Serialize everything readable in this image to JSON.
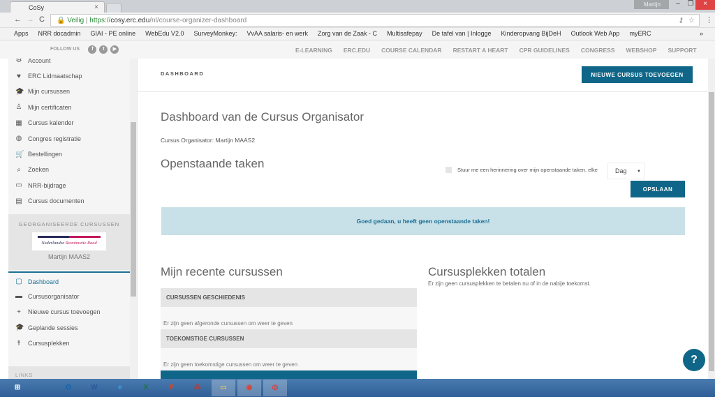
{
  "browser": {
    "tab_title": "CoSy",
    "user": "Martijn",
    "secure_label": "Veilig",
    "url_scheme": "https://",
    "url_host": "cosy.erc.edu",
    "url_path": "/nl/course-organizer-dashboard",
    "bookmarks": [
      "Apps",
      "NRR docadmin",
      "GIAI - PE online",
      "WebEdu V2.0",
      "SurveyMonkey:",
      "VvAA salaris- en werk",
      "Zorg van de Zaak - C",
      "Multisafepay",
      "De tafel van | Inlogge",
      "Kinderopvang BijDeH",
      "Outlook Web App",
      "myERC"
    ],
    "more": "»"
  },
  "topnav": {
    "follow_us": "FOLLOW US",
    "social": [
      "f",
      "t",
      "▶"
    ],
    "links": [
      "E-LEARNING",
      "ERC.EDU",
      "COURSE CALENDAR",
      "RESTART A HEART",
      "CPR GUIDELINES",
      "CONGRESS",
      "WEBSHOP",
      "SUPPORT"
    ]
  },
  "sidebar": {
    "items": [
      {
        "label": "Account",
        "icon": "gear-icon",
        "glyph": "⚙"
      },
      {
        "label": "ERC Lidmaatschap",
        "icon": "heart-icon",
        "glyph": "♥"
      },
      {
        "label": "Mijn cursussen",
        "icon": "graduation-cap-icon",
        "glyph": "🎓"
      },
      {
        "label": "Mijn certificaten",
        "icon": "certificate-icon",
        "glyph": "♙"
      },
      {
        "label": "Cursus kalender",
        "icon": "calendar-icon",
        "glyph": "▦"
      },
      {
        "label": "Congres registratie",
        "icon": "globe-icon",
        "glyph": "◍"
      },
      {
        "label": "Bestellingen",
        "icon": "cart-icon",
        "glyph": "🛒"
      },
      {
        "label": "Zoeken",
        "icon": "search-icon",
        "glyph": "⌕"
      },
      {
        "label": "NRR-bijdrage",
        "icon": "card-icon",
        "glyph": "▭"
      },
      {
        "label": "Cursus documenten",
        "icon": "document-icon",
        "glyph": "▤"
      }
    ],
    "org_header": "GEORGANISEERDE CURSUSSEN",
    "logo_text": "Nederlandse Reanimatie Raad",
    "org_user": "Martijn MAAS2",
    "org_items": [
      {
        "label": "Dashboard",
        "icon": "clipboard-icon",
        "glyph": "▢"
      },
      {
        "label": "Cursusorganisator",
        "icon": "briefcase-icon",
        "glyph": "▬"
      },
      {
        "label": "Nieuwe cursus toevoegen",
        "icon": "plus-icon",
        "glyph": "+"
      },
      {
        "label": "Geplande sessies",
        "icon": "graduation-cap-icon",
        "glyph": "🎓"
      },
      {
        "label": "Cursusplekken",
        "icon": "person-icon",
        "glyph": "☨"
      }
    ],
    "links_header": "LINKS"
  },
  "main": {
    "breadcrumb": "DASHBOARD",
    "new_course_button": "NIEUWE CURSUS TOEVOEGEN",
    "title": "Dashboard van de Cursus Organisator",
    "organizer": "Cursus Organisator: Martijn MAAS2",
    "tasks_title": "Openstaande taken",
    "reminder_label": "Stuur me een herinnering over mijn openstaande taken, elke",
    "reminder_checked": false,
    "frequency": "Dag",
    "save_button": "OPSLAAN",
    "alert": "Goed gedaan, u heeft geen openstaande taken!",
    "recent_title": "Mijn recente cursussen",
    "history_header": "CURSUSSEN GESCHIEDENIS",
    "history_empty": "Er zijn geen afgeronde cursussen om weer te geven",
    "future_header": "TOEKOMSTIGE CURSUSSEN",
    "future_empty": "Er zijn geen toekomstige cursussen om weer te geven",
    "seats_title": "Cursusplekken totalen",
    "seats_empty": "Er zijn geen cursusplekken te betalen nu of in de nabije toekomst.",
    "help": "?"
  },
  "taskbar": [
    {
      "name": "windows-start",
      "label": "⊞",
      "color": "#2e5e96"
    },
    {
      "name": "outlook",
      "label": "O",
      "color": "#0a64ad"
    },
    {
      "name": "word",
      "label": "W",
      "color": "#2b579a"
    },
    {
      "name": "internet-explorer",
      "label": "e",
      "color": "#3c9ee5"
    },
    {
      "name": "excel",
      "label": "X",
      "color": "#217346"
    },
    {
      "name": "powerpoint",
      "label": "P",
      "color": "#d24726"
    },
    {
      "name": "app",
      "label": "⁂",
      "color": "#c0392b"
    },
    {
      "name": "file-explorer",
      "label": "▭",
      "color": "#e8c35a"
    },
    {
      "name": "chrome",
      "label": "◉",
      "color": "#db4437"
    },
    {
      "name": "app-red",
      "label": "◎",
      "color": "#e53935"
    }
  ]
}
